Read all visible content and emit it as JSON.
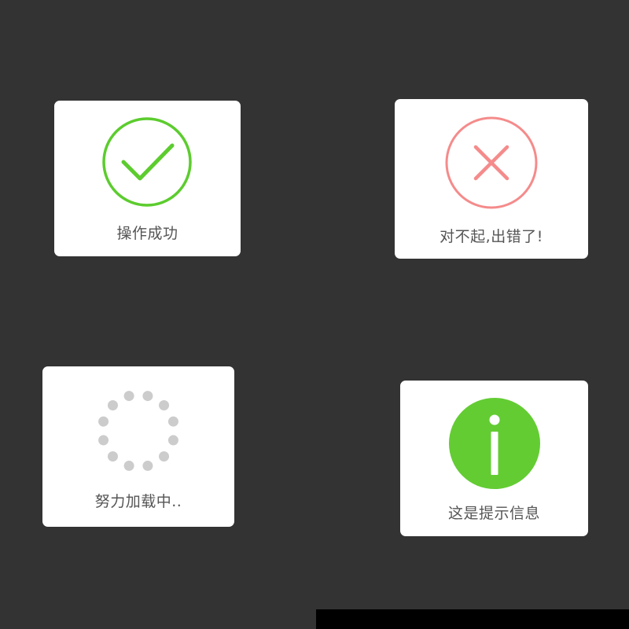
{
  "background_color": "#333333",
  "toasts": {
    "success": {
      "label": "操作成功",
      "icon": "check-circle-icon",
      "color": "#5ccc2e"
    },
    "error": {
      "label": "对不起,出错了!",
      "icon": "close-circle-icon",
      "color": "#f58b8b"
    },
    "loading": {
      "label": "努力加载中..",
      "icon": "loading-spinner-icon",
      "color": "#cccccc"
    },
    "info": {
      "label": "这是提示信息",
      "icon": "info-circle-icon",
      "color": "#63cc33"
    }
  }
}
